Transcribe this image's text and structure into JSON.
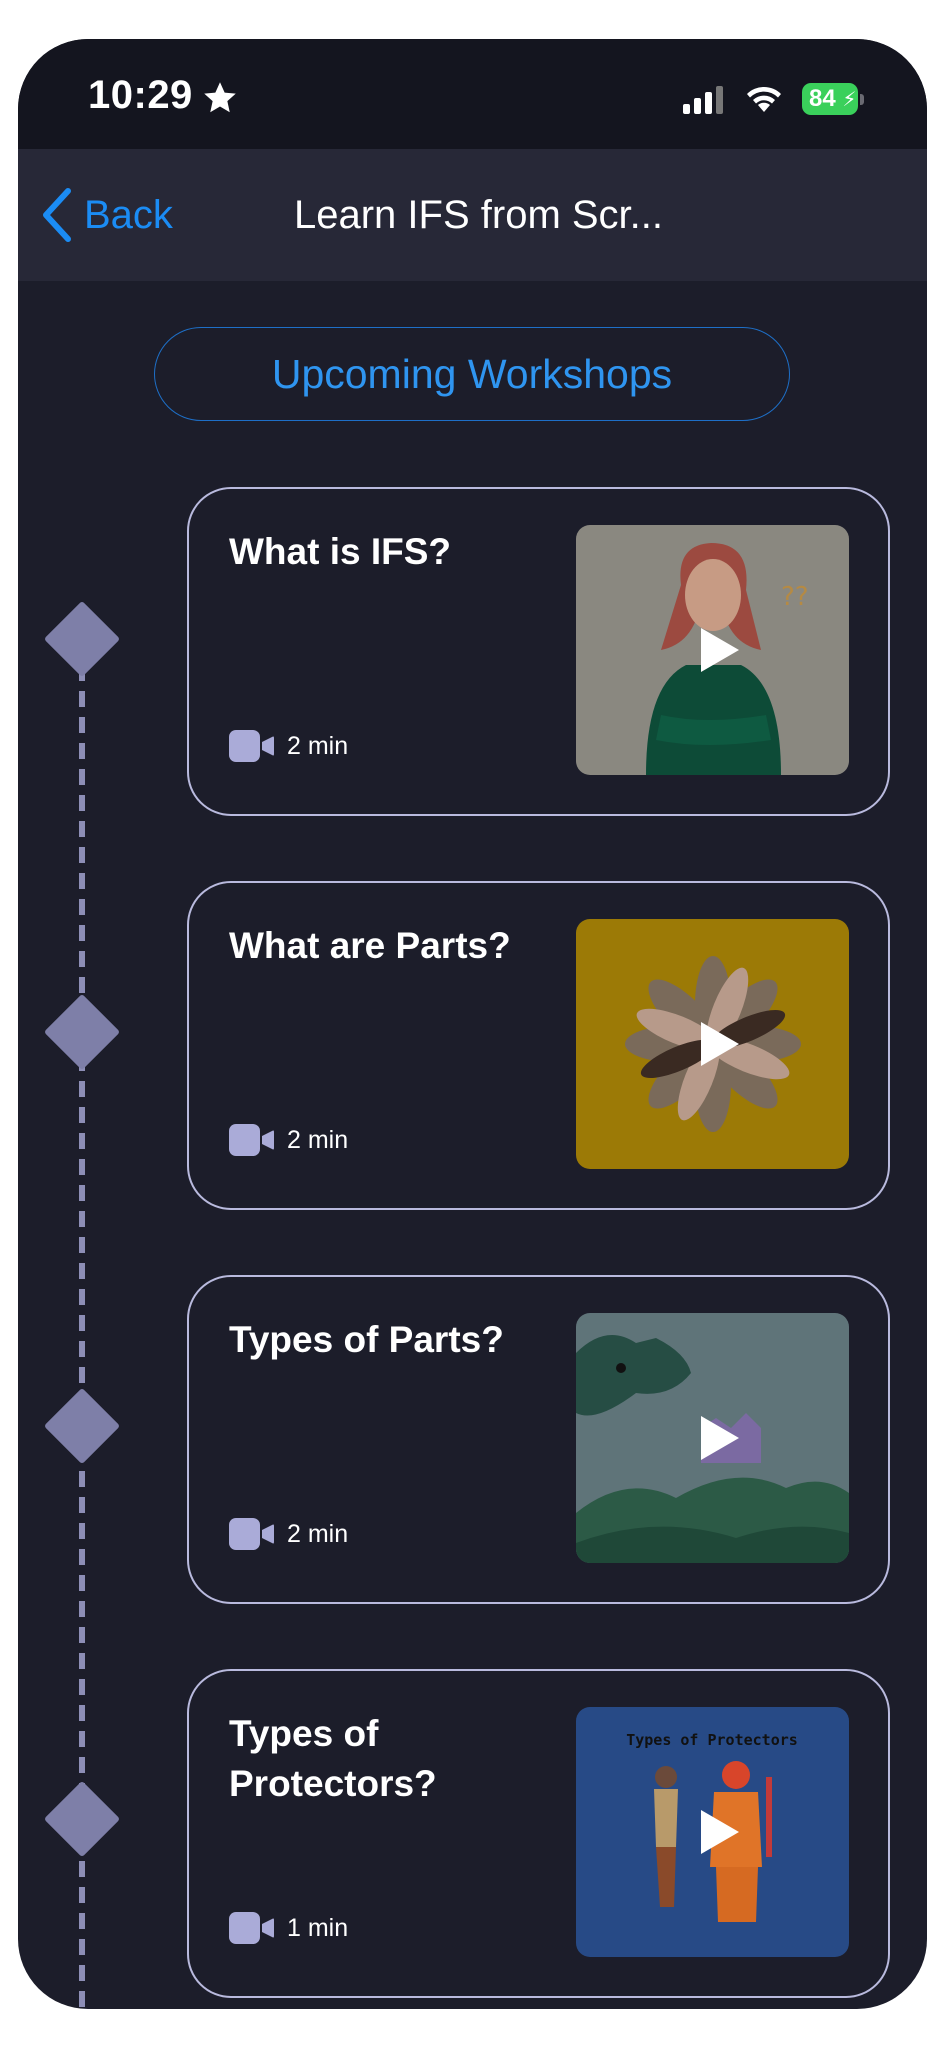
{
  "status_bar": {
    "time": "10:29",
    "battery": "84"
  },
  "nav": {
    "back_label": "Back",
    "title": "Learn IFS from Scr..."
  },
  "workshops_button": "Upcoming Workshops",
  "lessons": [
    {
      "title": "What is IFS?",
      "duration": "2 min",
      "thumb_bg": "#8a8880",
      "icon": "confused-woman-illustration"
    },
    {
      "title": "What are Parts?",
      "duration": "2 min",
      "thumb_bg": "#9c7a06",
      "icon": "hands-circle-illustration"
    },
    {
      "title": "Types of Parts?",
      "duration": "2 min",
      "thumb_bg": "#5f7479",
      "icon": "dragon-castle-illustration"
    },
    {
      "title": "Types of Protectors?",
      "duration": "1 min",
      "thumb_bg": "#274a86",
      "icon": "protectors-illustration",
      "thumb_caption": "Types of Protectors"
    }
  ],
  "colors": {
    "background": "#1c1d2a",
    "accent": "#1b8cf4",
    "card_border": "#b9bade",
    "timeline": "#7e7fa8"
  }
}
